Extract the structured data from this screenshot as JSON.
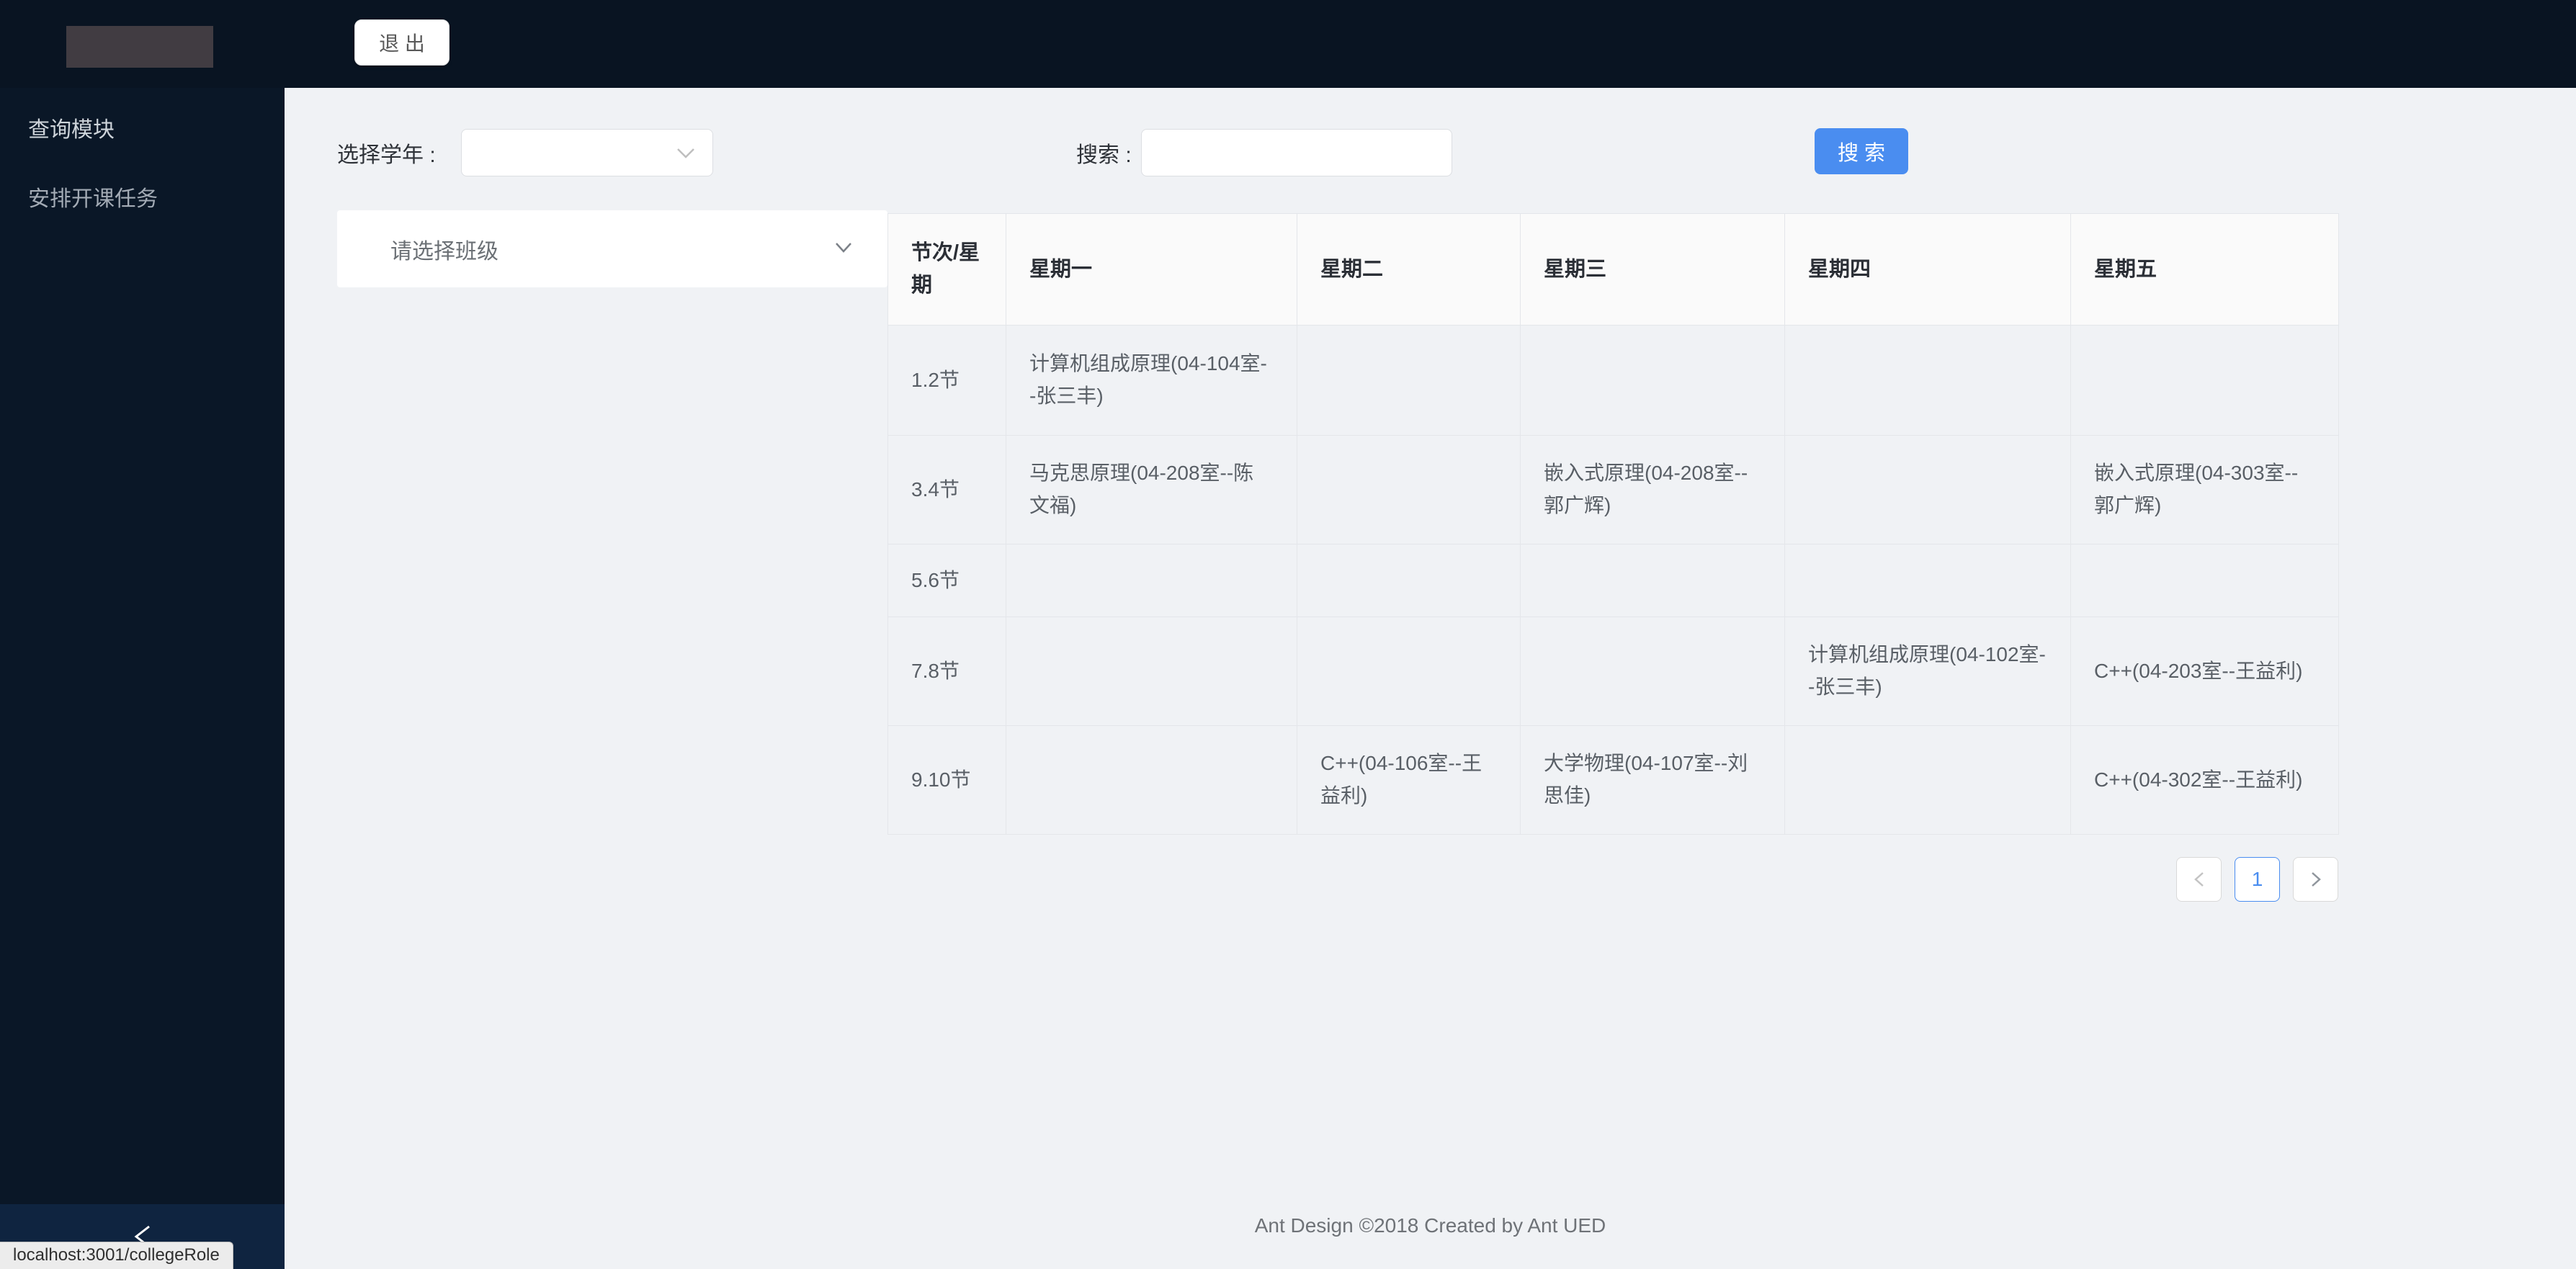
{
  "app": {
    "logout_label": "退 出",
    "footer_text": "Ant Design ©2018 Created by Ant UED",
    "status_bar": "localhost:3001/collegeRole"
  },
  "colors": {
    "primary_blue": "#4a8df0",
    "topbar_bg": "#091422",
    "sidebar_bg": "#0a1727",
    "trigger_bg": "#0f2440",
    "page_bg": "#f0f2f5",
    "table_header_bg": "#fafafa"
  },
  "sidebar": {
    "items": [
      {
        "label": "查询模块"
      },
      {
        "label": "安排开课任务"
      }
    ],
    "collapse_icon": "chevron-left"
  },
  "filters": {
    "year_label": "选择学年 :",
    "year_value": "",
    "year_select_icon": "chevron-down",
    "search_label": "搜索 :",
    "search_value": "",
    "search_button_label": "搜 索",
    "class_select_placeholder": "请选择班级",
    "class_select_icon": "chevron-down"
  },
  "table": {
    "columns": [
      "节次/星期",
      "星期一",
      "星期二",
      "星期三",
      "星期四",
      "星期五"
    ],
    "rows": [
      {
        "period": "1.2节",
        "cells": [
          "计算机组成原理(04-104室--张三丰)",
          "",
          "",
          "",
          ""
        ]
      },
      {
        "period": "3.4节",
        "cells": [
          "马克思原理(04-208室--陈文福)",
          "",
          "嵌入式原理(04-208室--郭广辉)",
          "",
          "嵌入式原理(04-303室--郭广辉)"
        ]
      },
      {
        "period": "5.6节",
        "cells": [
          "",
          "",
          "",
          "",
          ""
        ]
      },
      {
        "period": "7.8节",
        "cells": [
          "",
          "",
          "",
          "计算机组成原理(04-102室--张三丰)",
          "C++(04-203室--王益利)"
        ]
      },
      {
        "period": "9.10节",
        "cells": [
          "",
          "C++(04-106室--王益利)",
          "大学物理(04-107室--刘思佳)",
          "",
          "C++(04-302室--王益利)"
        ]
      }
    ]
  },
  "pagination": {
    "prev_icon": "chevron-left",
    "current_page": "1",
    "next_icon": "chevron-right"
  }
}
